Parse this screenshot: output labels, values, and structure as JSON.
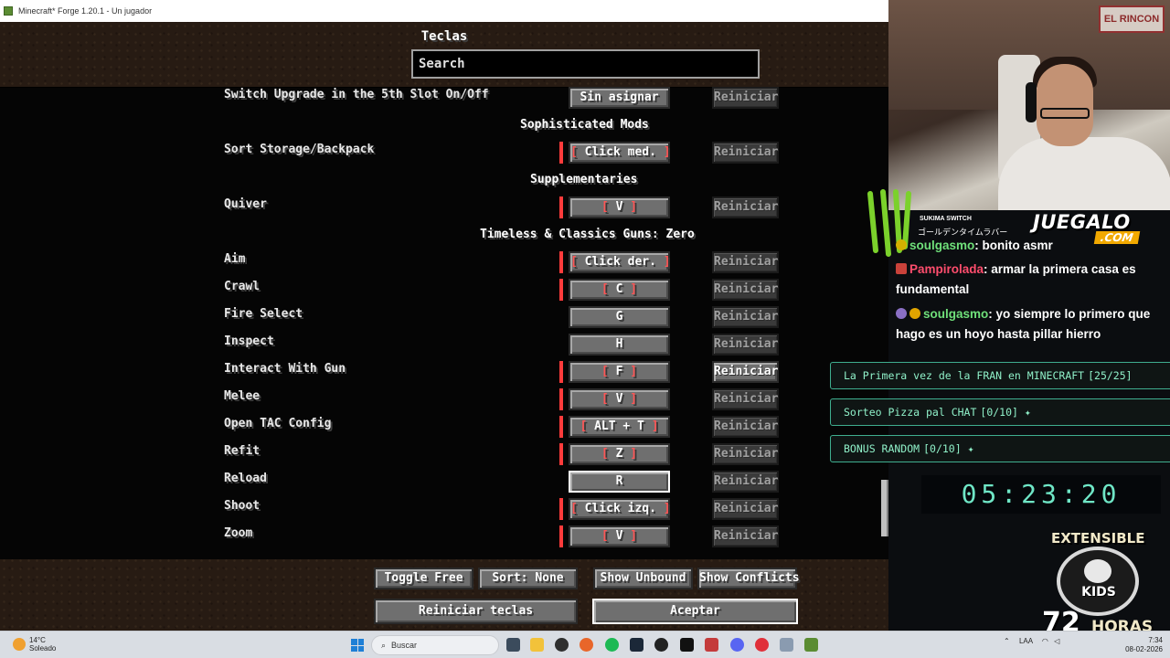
{
  "window": {
    "title": "Minecraft* Forge 1.20.1 - Un jugador"
  },
  "screen": {
    "title": "Teclas",
    "search": {
      "placeholder": "Search",
      "value": ""
    }
  },
  "rows": [
    {
      "type": "key",
      "label": "Switch Upgrade in the 5th Slot On/Off",
      "key": "Sin asignar",
      "conflict": false,
      "reset": "Reiniciar"
    },
    {
      "type": "category",
      "label": "Sophisticated Mods"
    },
    {
      "type": "key",
      "label": "Sort Storage/Backpack",
      "key_inner": "Click med.",
      "conflict": true,
      "reset": "Reiniciar"
    },
    {
      "type": "category",
      "label": "Supplementaries"
    },
    {
      "type": "key",
      "label": "Quiver",
      "key_inner": "V",
      "conflict": true,
      "reset": "Reiniciar"
    },
    {
      "type": "category",
      "label": "Timeless & Classics Guns: Zero"
    },
    {
      "type": "key",
      "label": "Aim",
      "key_inner": "Click der.",
      "conflict": true,
      "reset": "Reiniciar"
    },
    {
      "type": "key",
      "label": "Crawl",
      "key_inner": "C",
      "conflict": true,
      "reset": "Reiniciar"
    },
    {
      "type": "key",
      "label": "Fire Select",
      "key": "G",
      "conflict": false,
      "reset": "Reiniciar"
    },
    {
      "type": "key",
      "label": "Inspect",
      "key": "H",
      "conflict": false,
      "reset": "Reiniciar"
    },
    {
      "type": "key",
      "label": "Interact With Gun",
      "key_inner": "F",
      "conflict": true,
      "reset": "Reiniciar",
      "reset_active": true
    },
    {
      "type": "key",
      "label": "Melee",
      "key_inner": "V",
      "conflict": true,
      "reset": "Reiniciar"
    },
    {
      "type": "key",
      "label": "Open TAC Config",
      "key_inner": "ALT + T",
      "conflict": true,
      "reset": "Reiniciar"
    },
    {
      "type": "key",
      "label": "Refit",
      "key_inner": "Z",
      "conflict": true,
      "reset": "Reiniciar"
    },
    {
      "type": "key",
      "label": "Reload",
      "key": "R",
      "conflict": false,
      "reset": "Reiniciar",
      "selected": true
    },
    {
      "type": "key",
      "label": "Shoot",
      "key_inner": "Click izq.",
      "conflict": true,
      "reset": "Reiniciar"
    },
    {
      "type": "key",
      "label": "Zoom",
      "key_inner": "V",
      "conflict": true,
      "reset": "Reiniciar"
    }
  ],
  "footer": {
    "toggle_free": "Toggle Free",
    "sort": "Sort: None",
    "show_unbound": "Show Unbound",
    "show_conflicts": "Show Conflicts",
    "reset_keys": "Reiniciar teclas",
    "accept": "Aceptar"
  },
  "stream": {
    "cam_poster": "EL RINCON",
    "sponsor_small": "SUKIMA SWITCH",
    "sponsor_jp": "ゴールデンタイムラバー",
    "brand": "JUEGALO",
    "brand_domain": ".COM",
    "chat": [
      {
        "user": "soulgasmo",
        "message": ": bonito asmr",
        "color": "green"
      },
      {
        "user": "Pampirolada",
        "message": ": armar la primera casa es fundamental",
        "color": "red"
      },
      {
        "user": "soulgasmo",
        "message": ": yo siempre lo primero que hago es un hoyo hasta pillar hierro",
        "color": "green"
      }
    ],
    "goals": [
      {
        "text": "La Primera vez de la FRAN en MINECRAFT",
        "value": "[25/25]"
      },
      {
        "text": "Sorteo Pizza pal CHAT",
        "value": "[0/10]"
      },
      {
        "text": "BONUS RANDOM",
        "value": "[0/10]"
      }
    ],
    "timer": "05:23:20",
    "extensible": "EXTENSIBLE",
    "kids": "KIDS",
    "hours_num": "72",
    "hours_word": "HORAS"
  },
  "taskbar": {
    "weather_temp": "14°C",
    "weather_desc": "Soleado",
    "search_label": "Buscar",
    "tray_lang": "LAA",
    "time": "7:34",
    "date": "08-02-2026"
  },
  "colors": {
    "conflict": "#ff3b3b",
    "goal_text": "#8ff0c8",
    "timer": "#6fe6c6"
  }
}
